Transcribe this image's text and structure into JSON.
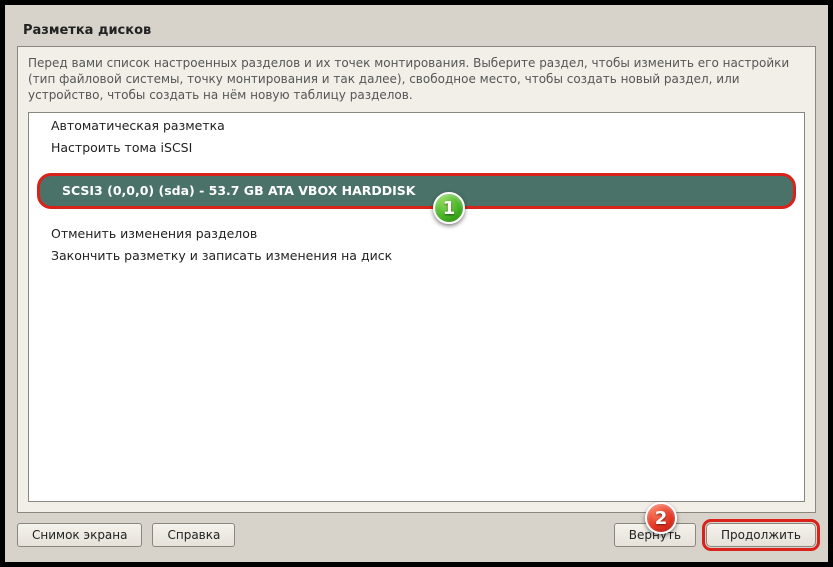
{
  "title": "Разметка дисков",
  "intro": "Перед вами список настроенных разделов и их точек монтирования. Выберите раздел, чтобы изменить его настройки (тип файловой системы, точку монтирования и так далее), свободное место, чтобы создать новый раздел, или устройство, чтобы создать на нём новую таблицу разделов.",
  "list": {
    "guided": "Автоматическая разметка",
    "iscsi": "Настроить тома iSCSI",
    "disk_selected": "SCSI3 (0,0,0) (sda) - 53.7 GB ATA VBOX HARDDISK",
    "undo": "Отменить изменения разделов",
    "finish": "Закончить разметку и записать изменения на диск"
  },
  "buttons": {
    "screenshot": "Снимок экрана",
    "help": "Справка",
    "back": "Вернуть",
    "continue": "Продолжить"
  },
  "callouts": {
    "one": "1",
    "two": "2"
  }
}
